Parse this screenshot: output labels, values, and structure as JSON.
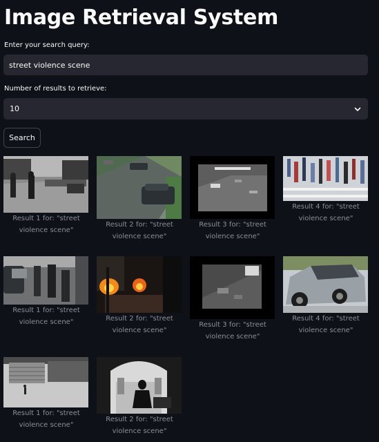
{
  "page": {
    "title": "Image Retrieval System"
  },
  "search": {
    "label": "Enter your search query:",
    "value": "street violence scene"
  },
  "num_results": {
    "label": "Number of results to retrieve:",
    "value": "10"
  },
  "search_button": {
    "label": "Search"
  },
  "results": [
    {
      "caption": "Result 1 for: \"street violence scene\"",
      "image": "police-officers-on-street-photo"
    },
    {
      "caption": "Result 2 for: \"street violence scene\"",
      "image": "street-with-parked-car-photo"
    },
    {
      "caption": "Result 3 for: \"street violence scene\"",
      "image": "cctv-street-footage-photo"
    },
    {
      "caption": "Result 4 for: \"street violence scene\"",
      "image": "crowd-crossing-street-photo"
    },
    {
      "caption": "Result 1 for: \"street violence scene\"",
      "image": "people-walking-by-cars-photo"
    },
    {
      "caption": "Result 2 for: \"street violence scene\"",
      "image": "street-fires-at-night-photo"
    },
    {
      "caption": "Result 3 for: \"street violence scene\"",
      "image": "night-cctv-street-photo"
    },
    {
      "caption": "Result 4 for: \"street violence scene\"",
      "image": "wrecked-car-photo"
    },
    {
      "caption": "Result 1 for: \"street violence scene\"",
      "image": "stairs-grayscale-photo"
    },
    {
      "caption": "Result 2 for: \"street violence scene\"",
      "image": "person-sitting-silhouette-photo"
    }
  ],
  "colors": {
    "background": "#0e1117",
    "input_background": "#262730",
    "text": "#fafafa",
    "caption": "#8c8f97"
  }
}
